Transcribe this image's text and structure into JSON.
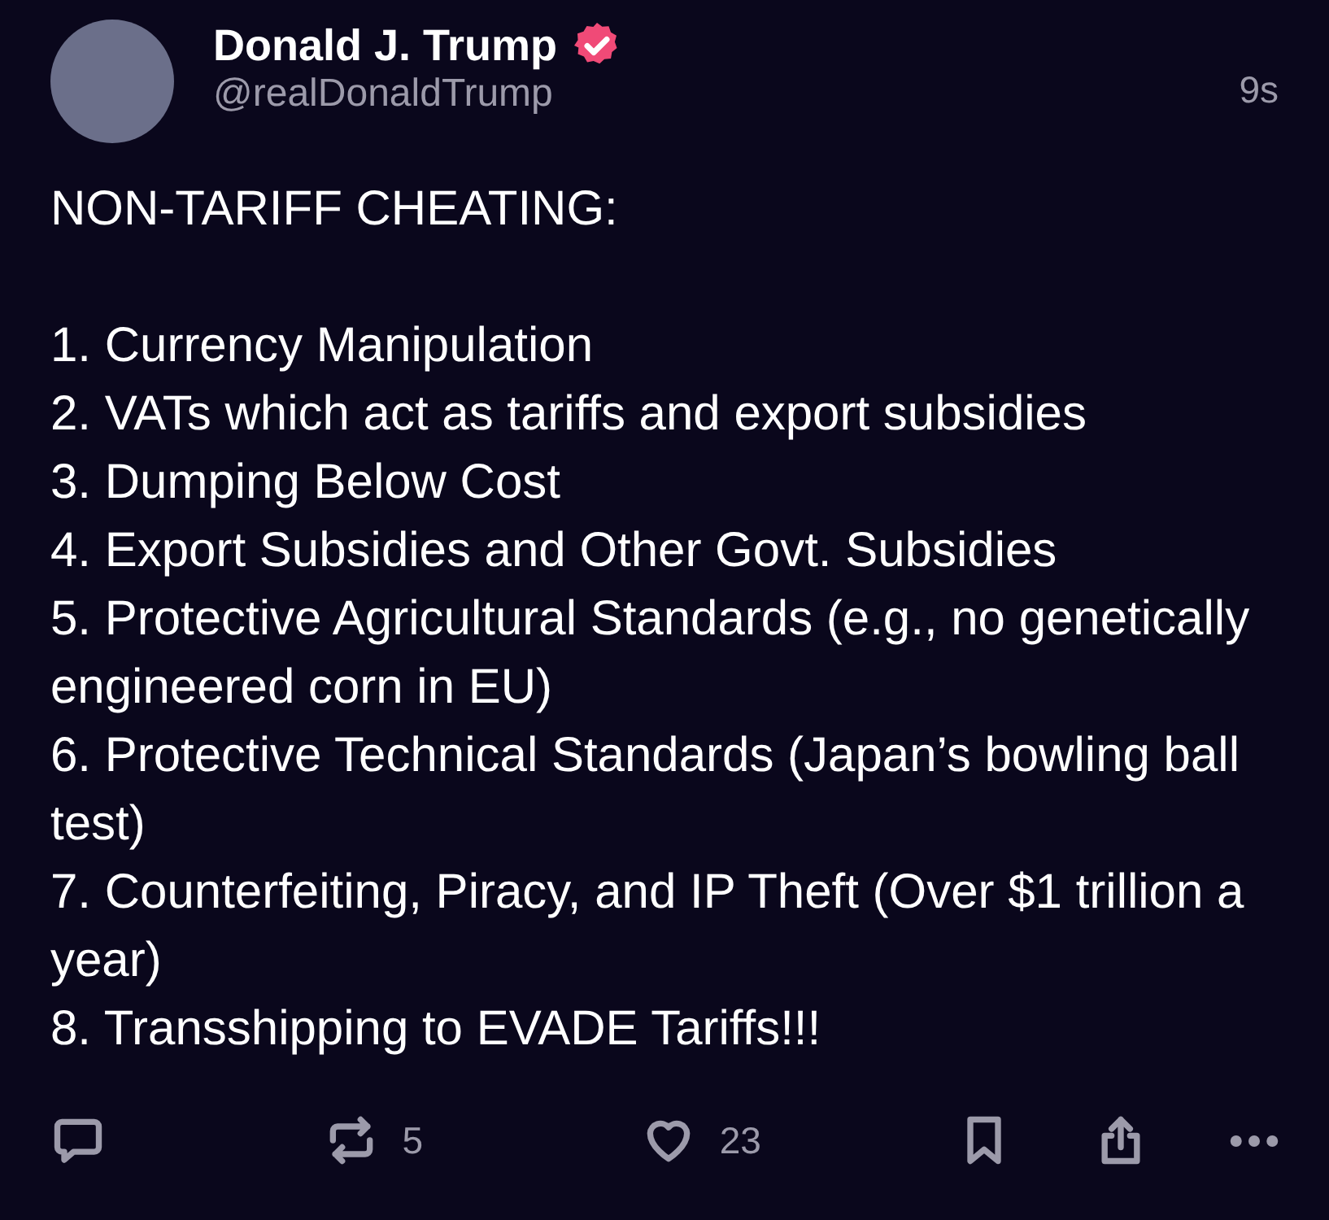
{
  "post": {
    "author": {
      "name": "Donald J. Trump",
      "verified": true,
      "handle": "@realDonaldTrump"
    },
    "time": "9s",
    "heading": "NON-TARIFF CHEATING:",
    "items": [
      "1. Currency Manipulation",
      "2. VATs which act as tariffs and export subsidies",
      "3. Dumping Below Cost",
      "4. Export Subsidies and Other Govt. Subsidies",
      "5. Protective Agricultural Standards (e.g., no genetically engineered corn in EU)",
      "6. Protective Technical Standards (Japan’s bowling ball test)",
      "7. Counterfeiting, Piracy, and IP Theft (Over $1 trillion a year)",
      "8. Transshipping to EVADE Tariffs!!!"
    ],
    "actions": {
      "reposts": "5",
      "likes": "23"
    }
  }
}
